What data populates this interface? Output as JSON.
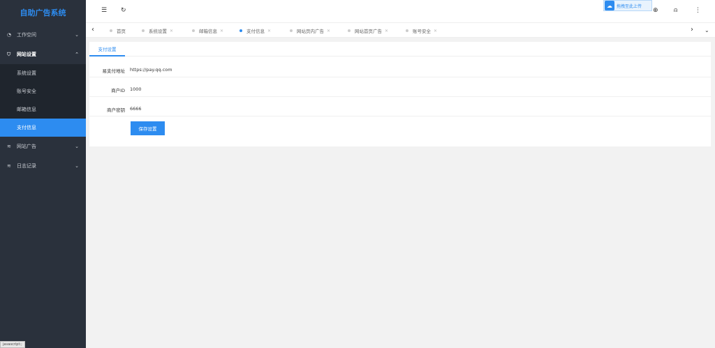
{
  "app": {
    "title": "自助广告系统"
  },
  "sidebar": {
    "workspace": {
      "label": "工作空间"
    },
    "site_settings": {
      "label": "网站设置",
      "items": [
        {
          "label": "系统设置"
        },
        {
          "label": "账号安全"
        },
        {
          "label": "邮箱信息"
        },
        {
          "label": "支付信息"
        }
      ]
    },
    "site_ads": {
      "label": "网站广告"
    },
    "logs": {
      "label": "日志记录"
    },
    "status_tip": "javascript:;"
  },
  "header": {
    "upload_badge": "拖拽至此上传"
  },
  "tabs": [
    {
      "label": "首页"
    },
    {
      "label": "系统设置"
    },
    {
      "label": "邮箱信息"
    },
    {
      "label": "支付信息"
    },
    {
      "label": "网站页内广告"
    },
    {
      "label": "网站首页广告"
    },
    {
      "label": "账号安全"
    }
  ],
  "form": {
    "tab_label": "支付设置",
    "fields": [
      {
        "label": "易支付地址",
        "value": "https://pay.qq.com"
      },
      {
        "label": "商户ID",
        "value": "1000"
      },
      {
        "label": "商户密钥",
        "value": "6666"
      }
    ],
    "save_label": "保存设置"
  },
  "colors": {
    "accent": "#2d8cf0",
    "sidebar_bg": "#2a313c"
  }
}
